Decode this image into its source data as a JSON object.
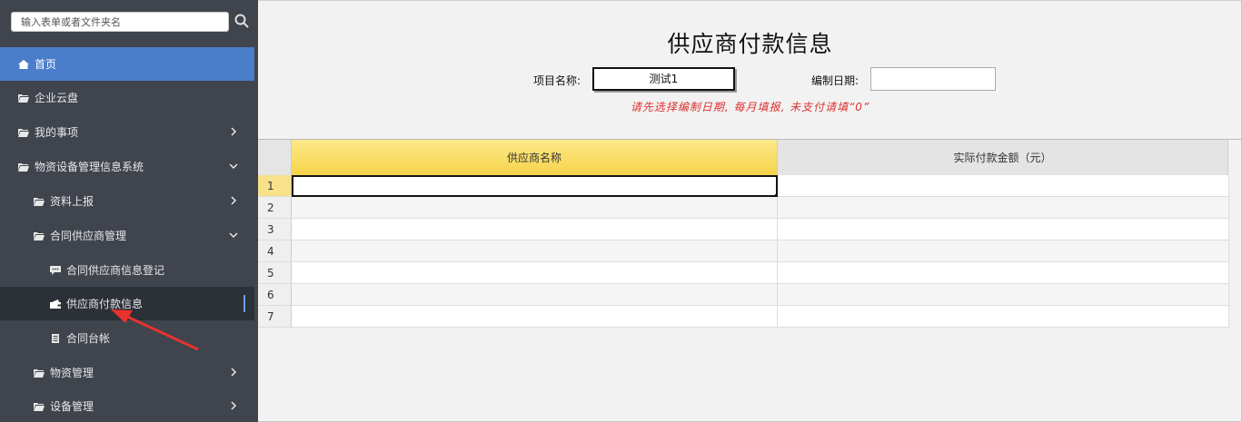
{
  "search": {
    "placeholder": "输入表单或者文件夹名"
  },
  "sidebar": {
    "items": [
      {
        "label": "首页"
      },
      {
        "label": "企业云盘"
      },
      {
        "label": "我的事项"
      },
      {
        "label": "物资设备管理信息系统"
      },
      {
        "label": "资料上报"
      },
      {
        "label": "合同供应商管理"
      },
      {
        "label": "合同供应商信息登记"
      },
      {
        "label": "供应商付款信息"
      },
      {
        "label": "合同台帐"
      },
      {
        "label": "物资管理"
      },
      {
        "label": "设备管理"
      }
    ]
  },
  "form": {
    "title": "供应商付款信息",
    "project_label": "项目名称:",
    "project_value": "测试1",
    "date_label": "编制日期:",
    "date_value": "",
    "notice": "请先选择编制日期, 每月填报, 未支付请填“0”"
  },
  "table": {
    "columns": [
      "供应商名称",
      "实际付款金额（元）"
    ],
    "row_numbers": [
      "1",
      "2",
      "3",
      "4",
      "5",
      "6",
      "7"
    ]
  },
  "colors": {
    "sidebar_bg": "#3f444d",
    "active_bg": "#4a7ecb",
    "notice": "#e03030",
    "header_highlight": "#f7d34a"
  }
}
